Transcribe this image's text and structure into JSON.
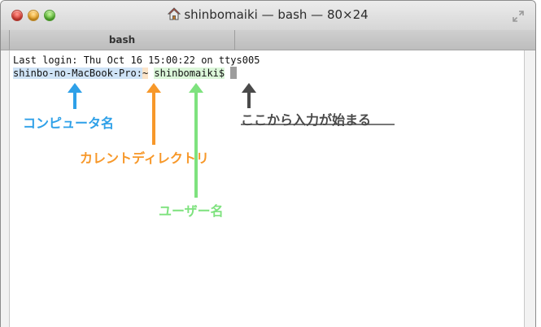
{
  "window": {
    "title": "shinbomaiki — bash — 80×24",
    "tab_label": "bash"
  },
  "terminal": {
    "last_login": "Last login: Thu Oct 16 15:00:22 on ttys005",
    "prompt_host": "shinbo-no-MacBook-Pro:",
    "prompt_dir": "~",
    "prompt_user": "shinbomaiki$"
  },
  "annotations": {
    "computer_name": "コンピュータ名",
    "current_directory": "カレントディレクトリ",
    "user_name": "ユーザー名",
    "input_start": "ここから入力が始まる"
  },
  "colors": {
    "computer_name": "#2ea0e8",
    "current_directory": "#f7982a",
    "user_name": "#7ee27e",
    "input_start": "#4a4a4a"
  },
  "icons": {
    "title_icon": "home-icon",
    "fullscreen": "fullscreen-icon"
  }
}
